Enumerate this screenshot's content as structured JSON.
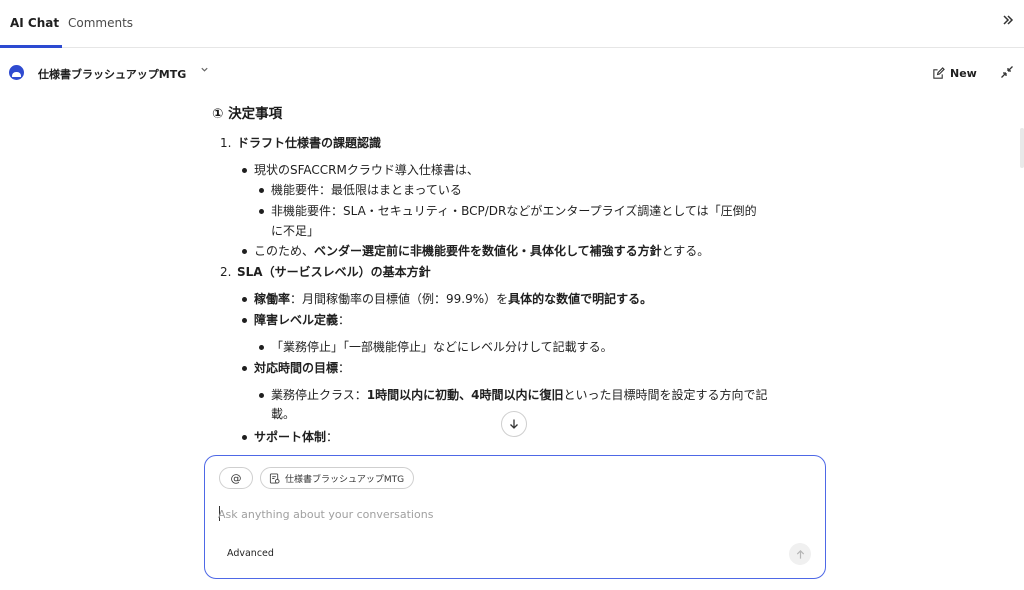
{
  "tabs": {
    "ai_chat": "AI Chat",
    "comments": "Comments"
  },
  "header": {
    "conversation_title": "仕様書ブラッシュアップMTG",
    "new_label": "New"
  },
  "content": {
    "section_title": "① 決定事項",
    "item1": {
      "number": "1.",
      "title": "ドラフト仕様書の課題認識",
      "bullet1": "現状のSFACCRMクラウド導入仕様書は、",
      "sub1": "機能要件：最低限はまとまっている",
      "sub2_line1": "非機能要件：SLA・セキュリティ・BCP/DRなどがエンタープライズ調達としては「圧倒的",
      "sub2_line2": "に不足」",
      "bullet2_a": "このため、",
      "bullet2_b": "ベンダー選定前に非機能要件を数値化・具体化して補強する方針",
      "bullet2_c": "とする。"
    },
    "item2": {
      "number": "2.",
      "title": "SLA（サービスレベル）の基本方針",
      "b1_label": "稼働率",
      "b1_text": "：月間稼働率の目標値（例：99.9%）を",
      "b1_bold": "具体的な数値で明記する。",
      "b2_label": "障害レベル定義",
      "b2_colon": "：",
      "b2_sub": "「業務停止」「一部機能停止」などにレベル分けして記載する。",
      "b3_label": "対応時間の目標",
      "b3_colon": "：",
      "b3_sub_a": "業務停止クラス：",
      "b3_sub_b": "1時間以内に初動、4時間以内に復旧",
      "b3_sub_c": "といった目標時間を設定する方向で記",
      "b3_sub_line2": "載。",
      "b4_label": "サポート体制",
      "b4_colon": "："
    }
  },
  "composer": {
    "mention_label": "@",
    "context_chip": "仕様書ブラッシュアップMTG",
    "placeholder": "Ask anything about your conversations",
    "advanced_label": "Advanced"
  },
  "icons": {
    "expand": "double-chevron-right-icon",
    "new": "edit-icon",
    "collapse": "collapse-arrows-icon",
    "scroll_down": "arrow-down-icon",
    "send": "arrow-up-icon",
    "chip": "document-icon"
  },
  "colors": {
    "accent": "#2c4ad1",
    "composer_border": "#4e68e6"
  }
}
